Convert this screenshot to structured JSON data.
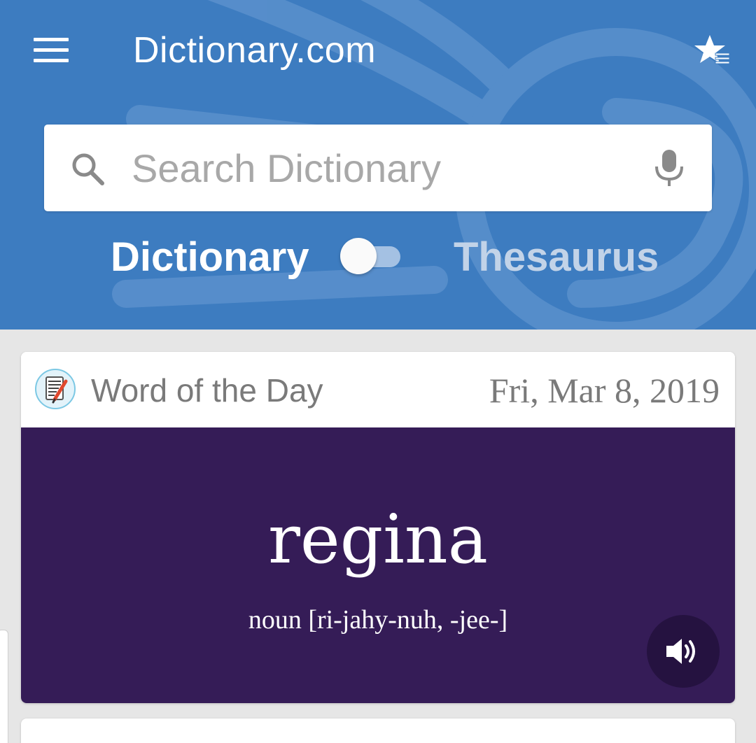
{
  "header": {
    "app_title": "Dictionary.com",
    "menu_icon": "hamburger-menu-icon",
    "favorites_icon": "star-list-icon",
    "background_color": "#3d7cc0"
  },
  "search": {
    "placeholder": "Search Dictionary",
    "value": "",
    "search_icon": "search-icon",
    "mic_icon": "microphone-icon"
  },
  "mode_toggle": {
    "left_label": "Dictionary",
    "right_label": "Thesaurus",
    "selected": "Dictionary"
  },
  "word_of_the_day": {
    "title": "Word of the Day",
    "date": "Fri, Mar 8, 2019",
    "word": "regina",
    "pronunciation": "noun [ri-jahy-nuh, -jee-]",
    "icon": "notepad-pencil-icon",
    "audio_icon": "speaker-icon",
    "background_color": "#351c57"
  }
}
